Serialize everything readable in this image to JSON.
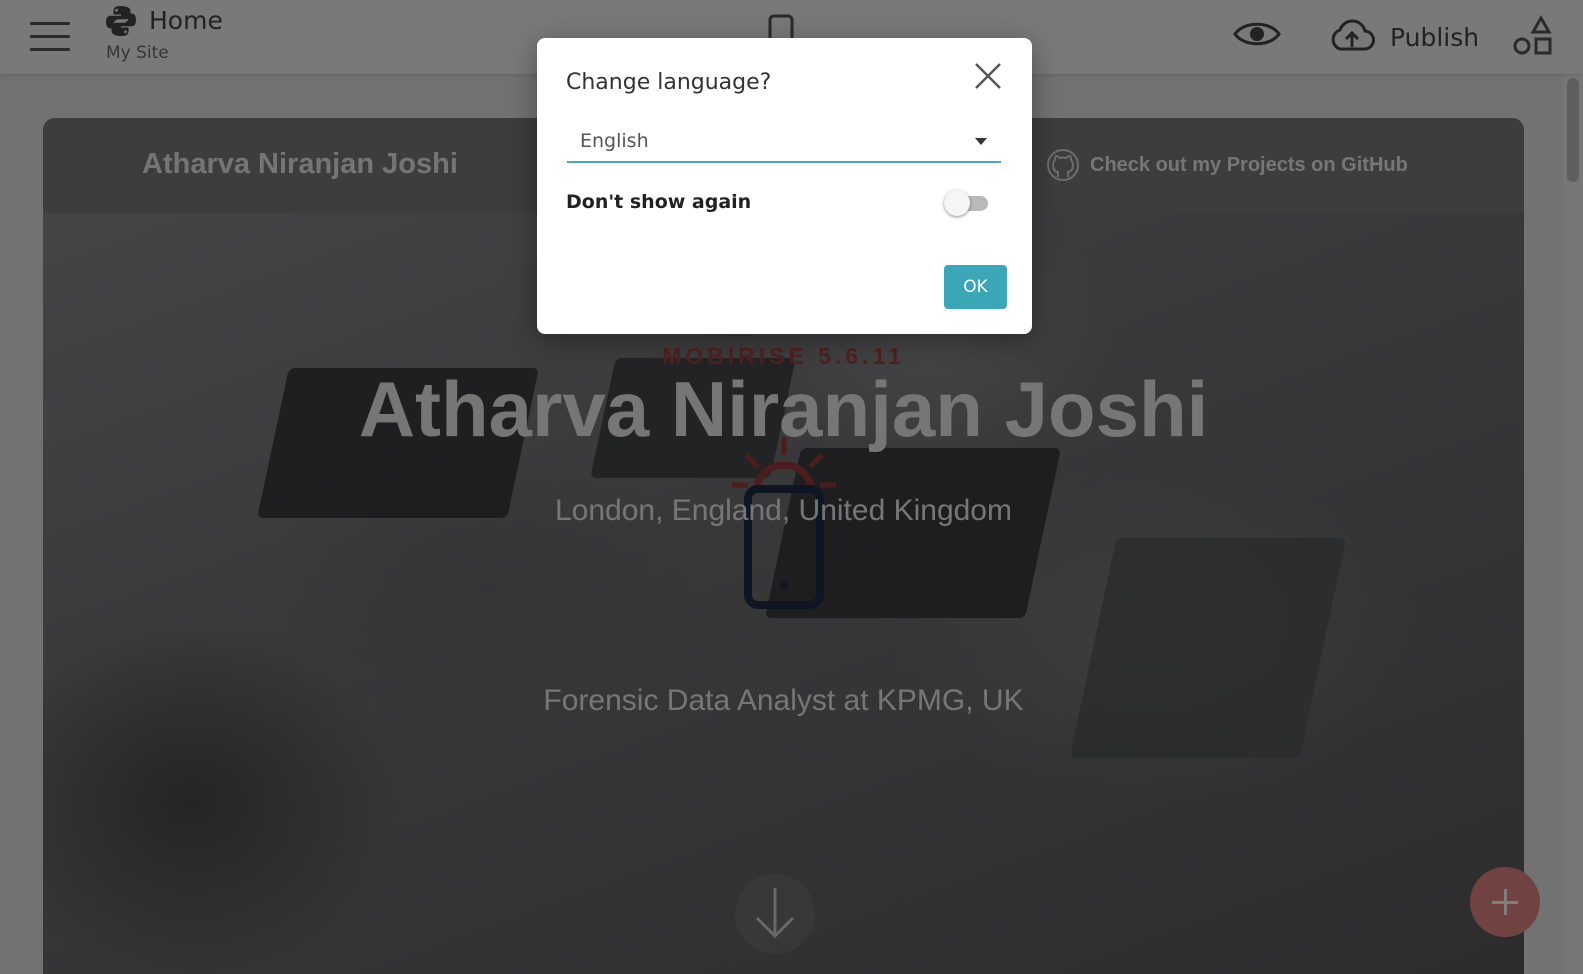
{
  "app": {
    "page_title": "Home",
    "site_name": "My Site",
    "publish_label": "Publish",
    "icons": {
      "menu": "hamburger-menu-icon",
      "python": "python-logo-icon",
      "device": "mobile-device-icon",
      "preview": "eye-icon",
      "publish": "cloud-upload-icon",
      "blocks": "shapes-icon"
    }
  },
  "site": {
    "brand": "Atharva Niranjan Joshi",
    "github_link": "Check out my Projects on GitHub",
    "hero": {
      "kicker": "MOBIRISE 5.6.11",
      "title": "Atharva Niranjan Joshi",
      "location": "London, England, United Kingdom",
      "role": "Forensic Data Analyst at KPMG, UK"
    },
    "colors": {
      "fab": "#e28585",
      "kicker": "#a04040"
    }
  },
  "dialog": {
    "title": "Change language?",
    "language_value": "English",
    "dont_show_label": "Don't show again",
    "dont_show_checked": false,
    "ok_label": "OK",
    "accent_color": "#3ba6b6"
  }
}
